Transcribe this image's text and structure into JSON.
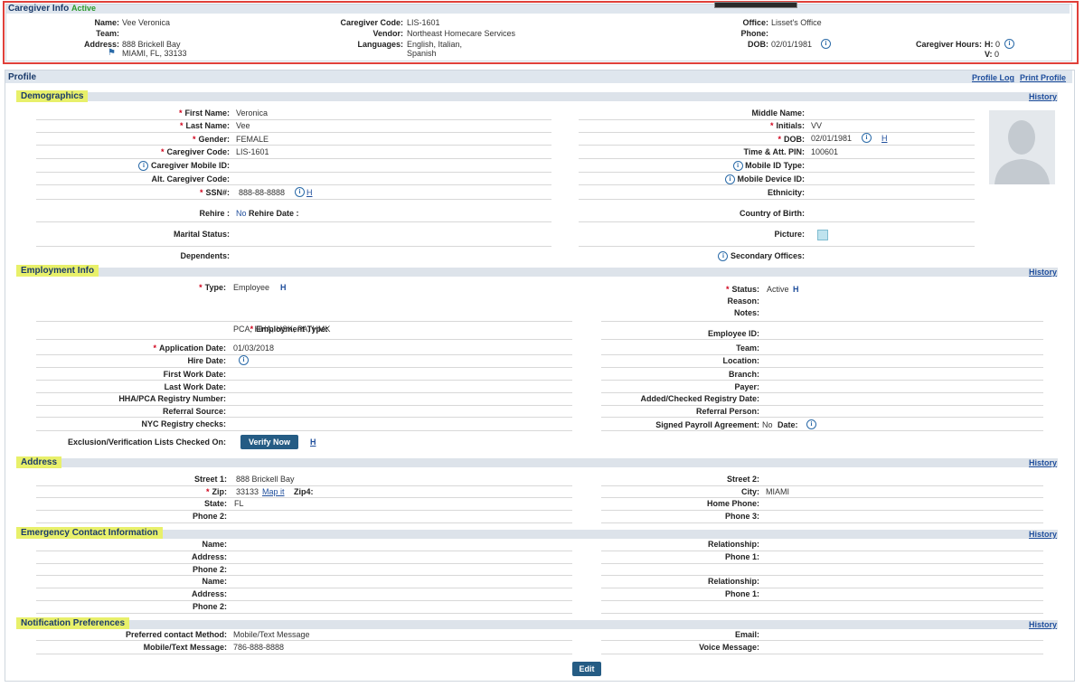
{
  "caregiver_info": {
    "title": "Caregiver Info",
    "status": "Active",
    "name_label": "Name:",
    "name": "Vee Veronica",
    "team_label": "Team:",
    "team": "",
    "address_label": "Address:",
    "address1": "888 Brickell Bay",
    "address2": "MIAMI, FL, 33133",
    "code_label": "Caregiver Code:",
    "code": "LIS-1601",
    "vendor_label": "Vendor:",
    "vendor": "Northeast Homecare Services",
    "languages_label": "Languages:",
    "languages1": "English, Italian,",
    "languages2": "Spanish",
    "office_label": "Office:",
    "office": "Lisset's Office",
    "phone_label": "Phone:",
    "phone": "",
    "dob_label": "DOB:",
    "dob": "02/01/1981",
    "hours_label": "Caregiver Hours:",
    "h_label": "H:",
    "h_value": "0",
    "v_label": "V:",
    "v_value": "0"
  },
  "profile": {
    "title": "Profile",
    "profile_log": "Profile Log",
    "print_profile": "Print Profile",
    "history": "History"
  },
  "demographics": {
    "title": "Demographics",
    "first_name_label": "First Name:",
    "first_name": "Veronica",
    "last_name_label": "Last Name:",
    "last_name": "Vee",
    "gender_label": "Gender:",
    "gender": "FEMALE",
    "code_label": "Caregiver Code:",
    "code": "LIS-1601",
    "mobile_id_label": "Caregiver Mobile ID:",
    "alt_code_label": "Alt. Caregiver Code:",
    "ssn_label": "SSN#:",
    "ssn": "888-88-8888",
    "h_link": "H",
    "rehire_label": "Rehire :",
    "rehire": "No",
    "rehire_date_label": "Rehire Date :",
    "marital_label": "Marital Status:",
    "dependents_label": "Dependents:",
    "middle_name_label": "Middle Name:",
    "initials_label": "Initials:",
    "initials": "VV",
    "dob_label": "DOB:",
    "dob": "02/01/1981",
    "pin_label": "Time & Att. PIN:",
    "pin": "100601",
    "mobile_id_type_label": "Mobile ID Type:",
    "mobile_device_label": "Mobile Device ID:",
    "ethnicity_label": "Ethnicity:",
    "country_label": "Country of Birth:",
    "picture_label": "Picture:",
    "secondary_offices_label": "Secondary Offices:"
  },
  "employment": {
    "title": "Employment Info",
    "type_label": "Type:",
    "type": "Employee",
    "h": "H",
    "status_label": "Status:",
    "status": "Active",
    "reason_label": "Reason:",
    "notes_label": "Notes:",
    "emp_type_label": "Employment Type:",
    "emp_type": "PCA, HHA, HSK, PA, HMK",
    "app_date_label": "Application Date:",
    "app_date": "01/03/2018",
    "hire_date_label": "Hire Date:",
    "first_work_label": "First Work Date:",
    "last_work_label": "Last Work Date:",
    "registry_label": "HHA/PCA Registry Number:",
    "referral_source_label": "Referral Source:",
    "nyc_label": "NYC Registry checks:",
    "exclusion_label": "Exclusion/Verification Lists Checked On:",
    "verify_button": "Verify Now",
    "employee_id_label": "Employee ID:",
    "team_label": "Team:",
    "location_label": "Location:",
    "branch_label": "Branch:",
    "payer_label": "Payer:",
    "added_label": "Added/Checked Registry Date:",
    "referral_person_label": "Referral Person:",
    "signed_label": "Signed Payroll Agreement:",
    "signed": "No",
    "date_label": "Date:"
  },
  "address": {
    "title": "Address",
    "street1_label": "Street 1:",
    "street1": "888 Brickell Bay",
    "zip_label": "Zip:",
    "zip": "33133",
    "map_it": "Map it",
    "zip4_label": "Zip4:",
    "state_label": "State:",
    "state": "FL",
    "phone2_label": "Phone 2:",
    "street2_label": "Street 2:",
    "city_label": "City:",
    "city": "MIAMI",
    "home_phone_label": "Home Phone:",
    "phone3_label": "Phone 3:"
  },
  "emergency": {
    "title": "Emergency Contact Information",
    "name_label": "Name:",
    "address_label": "Address:",
    "phone2_label": "Phone 2:",
    "relationship_label": "Relationship:",
    "phone1_label": "Phone 1:"
  },
  "notification": {
    "title": "Notification Preferences",
    "method_label": "Preferred contact Method:",
    "method": "Mobile/Text Message",
    "mobile_label": "Mobile/Text Message:",
    "mobile": "786-888-8888",
    "email_label": "Email:",
    "voice_label": "Voice Message:"
  },
  "edit_button": "Edit"
}
